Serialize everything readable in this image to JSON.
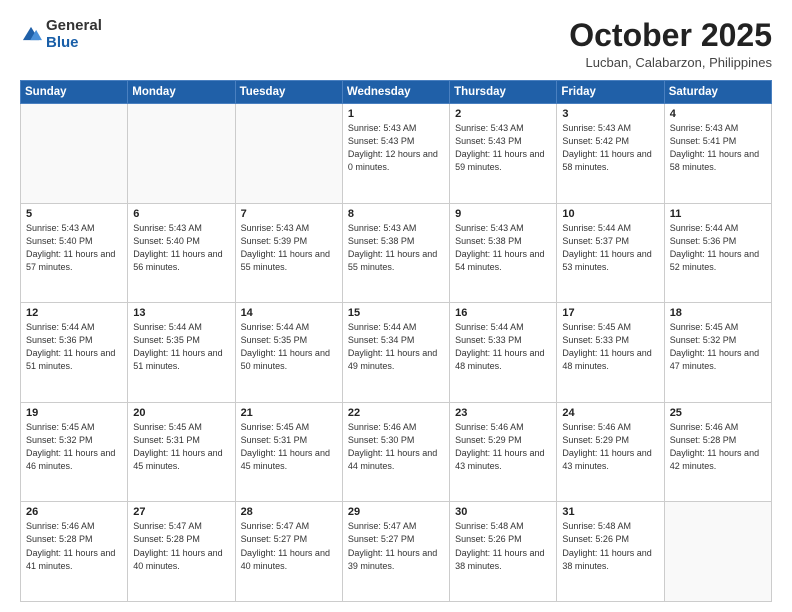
{
  "header": {
    "logo": {
      "line1": "General",
      "line2": "Blue"
    },
    "month": "October 2025",
    "location": "Lucban, Calabarzon, Philippines"
  },
  "weekdays": [
    "Sunday",
    "Monday",
    "Tuesday",
    "Wednesday",
    "Thursday",
    "Friday",
    "Saturday"
  ],
  "weeks": [
    [
      {
        "day": "",
        "sunrise": "",
        "sunset": "",
        "daylight": "",
        "empty": true
      },
      {
        "day": "",
        "sunrise": "",
        "sunset": "",
        "daylight": "",
        "empty": true
      },
      {
        "day": "",
        "sunrise": "",
        "sunset": "",
        "daylight": "",
        "empty": true
      },
      {
        "day": "1",
        "sunrise": "Sunrise: 5:43 AM",
        "sunset": "Sunset: 5:43 PM",
        "daylight": "Daylight: 12 hours and 0 minutes."
      },
      {
        "day": "2",
        "sunrise": "Sunrise: 5:43 AM",
        "sunset": "Sunset: 5:43 PM",
        "daylight": "Daylight: 11 hours and 59 minutes."
      },
      {
        "day": "3",
        "sunrise": "Sunrise: 5:43 AM",
        "sunset": "Sunset: 5:42 PM",
        "daylight": "Daylight: 11 hours and 58 minutes."
      },
      {
        "day": "4",
        "sunrise": "Sunrise: 5:43 AM",
        "sunset": "Sunset: 5:41 PM",
        "daylight": "Daylight: 11 hours and 58 minutes."
      }
    ],
    [
      {
        "day": "5",
        "sunrise": "Sunrise: 5:43 AM",
        "sunset": "Sunset: 5:40 PM",
        "daylight": "Daylight: 11 hours and 57 minutes."
      },
      {
        "day": "6",
        "sunrise": "Sunrise: 5:43 AM",
        "sunset": "Sunset: 5:40 PM",
        "daylight": "Daylight: 11 hours and 56 minutes."
      },
      {
        "day": "7",
        "sunrise": "Sunrise: 5:43 AM",
        "sunset": "Sunset: 5:39 PM",
        "daylight": "Daylight: 11 hours and 55 minutes."
      },
      {
        "day": "8",
        "sunrise": "Sunrise: 5:43 AM",
        "sunset": "Sunset: 5:38 PM",
        "daylight": "Daylight: 11 hours and 55 minutes."
      },
      {
        "day": "9",
        "sunrise": "Sunrise: 5:43 AM",
        "sunset": "Sunset: 5:38 PM",
        "daylight": "Daylight: 11 hours and 54 minutes."
      },
      {
        "day": "10",
        "sunrise": "Sunrise: 5:44 AM",
        "sunset": "Sunset: 5:37 PM",
        "daylight": "Daylight: 11 hours and 53 minutes."
      },
      {
        "day": "11",
        "sunrise": "Sunrise: 5:44 AM",
        "sunset": "Sunset: 5:36 PM",
        "daylight": "Daylight: 11 hours and 52 minutes."
      }
    ],
    [
      {
        "day": "12",
        "sunrise": "Sunrise: 5:44 AM",
        "sunset": "Sunset: 5:36 PM",
        "daylight": "Daylight: 11 hours and 51 minutes."
      },
      {
        "day": "13",
        "sunrise": "Sunrise: 5:44 AM",
        "sunset": "Sunset: 5:35 PM",
        "daylight": "Daylight: 11 hours and 51 minutes."
      },
      {
        "day": "14",
        "sunrise": "Sunrise: 5:44 AM",
        "sunset": "Sunset: 5:35 PM",
        "daylight": "Daylight: 11 hours and 50 minutes."
      },
      {
        "day": "15",
        "sunrise": "Sunrise: 5:44 AM",
        "sunset": "Sunset: 5:34 PM",
        "daylight": "Daylight: 11 hours and 49 minutes."
      },
      {
        "day": "16",
        "sunrise": "Sunrise: 5:44 AM",
        "sunset": "Sunset: 5:33 PM",
        "daylight": "Daylight: 11 hours and 48 minutes."
      },
      {
        "day": "17",
        "sunrise": "Sunrise: 5:45 AM",
        "sunset": "Sunset: 5:33 PM",
        "daylight": "Daylight: 11 hours and 48 minutes."
      },
      {
        "day": "18",
        "sunrise": "Sunrise: 5:45 AM",
        "sunset": "Sunset: 5:32 PM",
        "daylight": "Daylight: 11 hours and 47 minutes."
      }
    ],
    [
      {
        "day": "19",
        "sunrise": "Sunrise: 5:45 AM",
        "sunset": "Sunset: 5:32 PM",
        "daylight": "Daylight: 11 hours and 46 minutes."
      },
      {
        "day": "20",
        "sunrise": "Sunrise: 5:45 AM",
        "sunset": "Sunset: 5:31 PM",
        "daylight": "Daylight: 11 hours and 45 minutes."
      },
      {
        "day": "21",
        "sunrise": "Sunrise: 5:45 AM",
        "sunset": "Sunset: 5:31 PM",
        "daylight": "Daylight: 11 hours and 45 minutes."
      },
      {
        "day": "22",
        "sunrise": "Sunrise: 5:46 AM",
        "sunset": "Sunset: 5:30 PM",
        "daylight": "Daylight: 11 hours and 44 minutes."
      },
      {
        "day": "23",
        "sunrise": "Sunrise: 5:46 AM",
        "sunset": "Sunset: 5:29 PM",
        "daylight": "Daylight: 11 hours and 43 minutes."
      },
      {
        "day": "24",
        "sunrise": "Sunrise: 5:46 AM",
        "sunset": "Sunset: 5:29 PM",
        "daylight": "Daylight: 11 hours and 43 minutes."
      },
      {
        "day": "25",
        "sunrise": "Sunrise: 5:46 AM",
        "sunset": "Sunset: 5:28 PM",
        "daylight": "Daylight: 11 hours and 42 minutes."
      }
    ],
    [
      {
        "day": "26",
        "sunrise": "Sunrise: 5:46 AM",
        "sunset": "Sunset: 5:28 PM",
        "daylight": "Daylight: 11 hours and 41 minutes."
      },
      {
        "day": "27",
        "sunrise": "Sunrise: 5:47 AM",
        "sunset": "Sunset: 5:28 PM",
        "daylight": "Daylight: 11 hours and 40 minutes."
      },
      {
        "day": "28",
        "sunrise": "Sunrise: 5:47 AM",
        "sunset": "Sunset: 5:27 PM",
        "daylight": "Daylight: 11 hours and 40 minutes."
      },
      {
        "day": "29",
        "sunrise": "Sunrise: 5:47 AM",
        "sunset": "Sunset: 5:27 PM",
        "daylight": "Daylight: 11 hours and 39 minutes."
      },
      {
        "day": "30",
        "sunrise": "Sunrise: 5:48 AM",
        "sunset": "Sunset: 5:26 PM",
        "daylight": "Daylight: 11 hours and 38 minutes."
      },
      {
        "day": "31",
        "sunrise": "Sunrise: 5:48 AM",
        "sunset": "Sunset: 5:26 PM",
        "daylight": "Daylight: 11 hours and 38 minutes."
      },
      {
        "day": "",
        "sunrise": "",
        "sunset": "",
        "daylight": "",
        "empty": true
      }
    ]
  ]
}
